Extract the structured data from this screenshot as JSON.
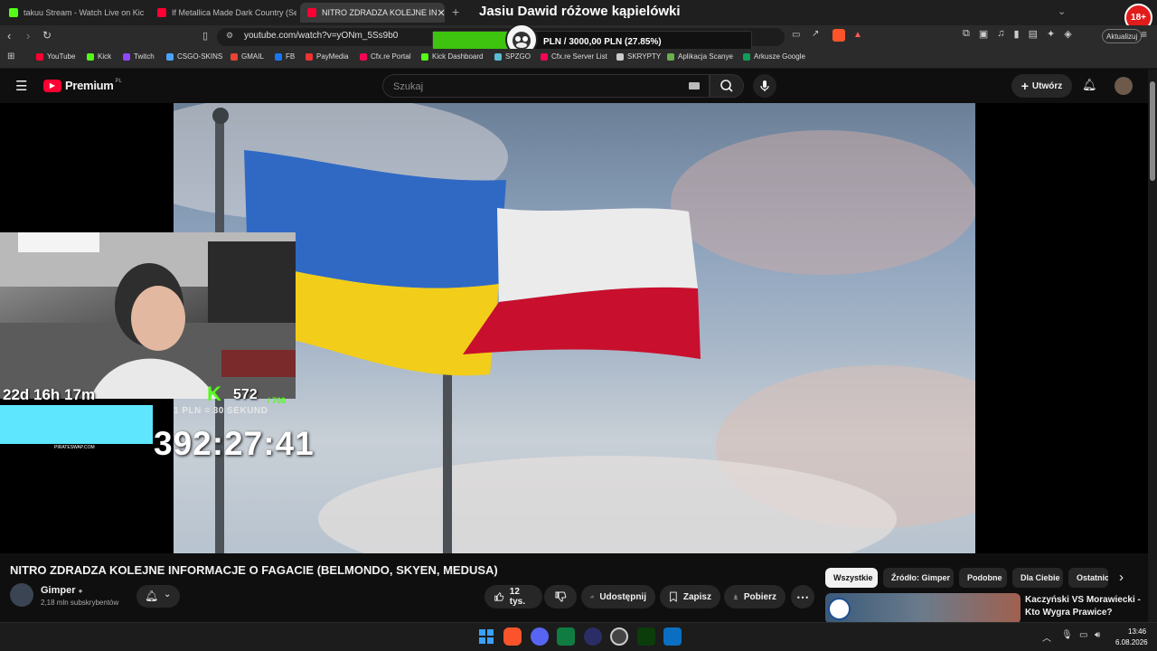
{
  "browser": {
    "tabs": [
      {
        "label": "takuu Stream - Watch Live on Kic",
        "color": "#53fc18"
      },
      {
        "label": "If Metallica Made Dark Country (Seri",
        "color": "#ff0033"
      },
      {
        "label": "NITRO ZDRADZA KOLEJNE IN",
        "color": "#ff0033",
        "active": true
      }
    ],
    "url": "youtube.com/watch?v=yONm_5Ss9b0",
    "update_label": "Aktualizuj",
    "age_badge": "18+"
  },
  "overlay": {
    "stream_title": "Jasiu Dawid różowe kąpielówki",
    "donation_goal": "PLN / 3000,00 PLN  (27.85%)",
    "donation_progress": 0.2785,
    "sub_timer": "22d 16h 17m",
    "kick_followers": "572",
    "kick_goal": "/ 700",
    "rate": "1 PLN = 30 SEKUND",
    "countdown": "392:27:41",
    "ad_label": "PIRATESWAP.COM"
  },
  "bookmarks": [
    {
      "label": "YouTube",
      "color": "#ff0033"
    },
    {
      "label": "Kick",
      "color": "#53fc18"
    },
    {
      "label": "Twitch",
      "color": "#9146ff"
    },
    {
      "label": "CSGO-SKINS",
      "color": "#4aa3ff"
    },
    {
      "label": "GMAIL",
      "color": "#ea4335"
    },
    {
      "label": "FB",
      "color": "#1877f2"
    },
    {
      "label": "PayMedia",
      "color": "#e33"
    },
    {
      "label": "Cfx.re Portal",
      "color": "#f40552"
    },
    {
      "label": "Kick Dashboard",
      "color": "#53fc18"
    },
    {
      "label": "SPZGO",
      "color": "#5bbbd6"
    },
    {
      "label": "Cfx.re Server List",
      "color": "#f40552"
    },
    {
      "label": "SKRYPTY",
      "color": "#cccccc"
    },
    {
      "label": "Aplikacja Scanye",
      "color": "#6ab04c"
    },
    {
      "label": "Arkusze Google",
      "color": "#0f9d58"
    }
  ],
  "youtube": {
    "logo_text": "Premium",
    "logo_region": "PL",
    "search_placeholder": "Szukaj",
    "create_label": "Utwórz",
    "video_title": "NITRO ZDRADZA KOLEJNE INFORMACJE O FAGACIE (BELMONDO, SKYEN, MEDUSA)",
    "channel": {
      "name": "Gimper",
      "subscribers": "2,18 mln subskrybentów"
    },
    "actions": {
      "likes": "12 tys.",
      "share": "Udostępnij",
      "save": "Zapisz",
      "download": "Pobierz"
    },
    "chips": [
      "Wszystkie",
      "Źródło: Gimper",
      "Podobne",
      "Dla Ciebie",
      "Ostatnio"
    ],
    "recommended": {
      "title": "Kaczyński VS Morawiecki - Kto Wygra Prawice?"
    }
  },
  "taskbar": {
    "time": "13:46",
    "date": "6.08.2026"
  }
}
